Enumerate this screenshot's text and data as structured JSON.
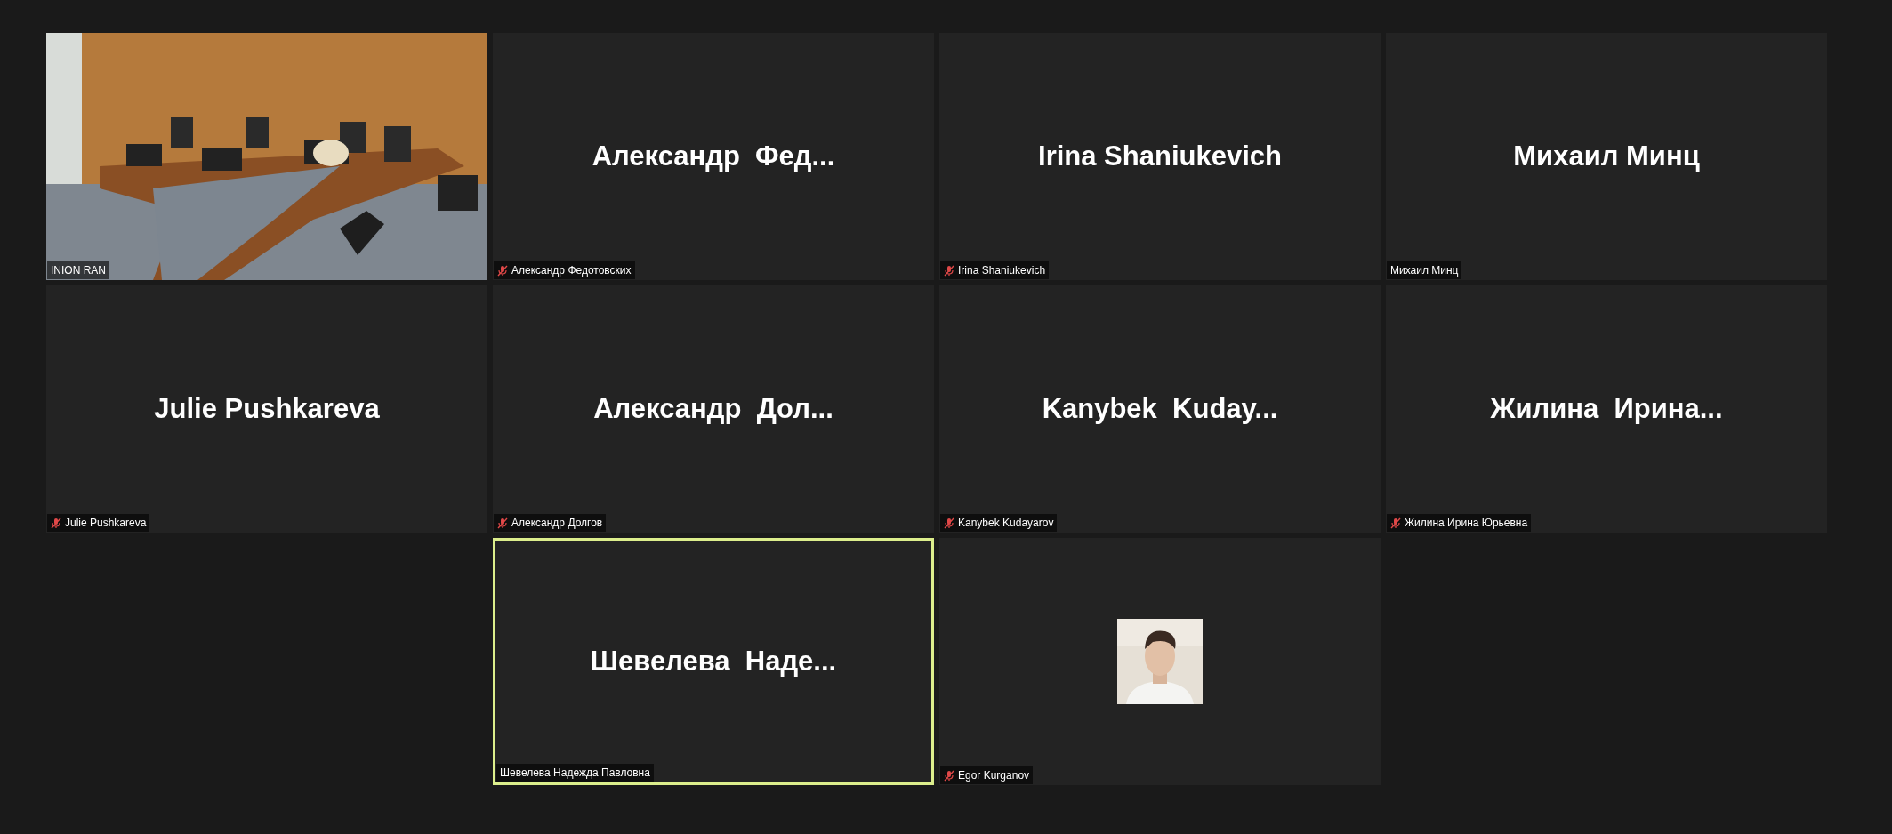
{
  "tiles": [
    {
      "kind": "video",
      "label": "INION RAN",
      "muted": false,
      "active_speaker": false
    },
    {
      "kind": "name",
      "display_name": "Александр  Фед...",
      "label": "Александр Федотовских",
      "muted": true,
      "active_speaker": false
    },
    {
      "kind": "name",
      "display_name": "Irina Shaniukevich",
      "label": "Irina Shaniukevich",
      "muted": true,
      "active_speaker": false
    },
    {
      "kind": "name",
      "display_name": "Михаил Минц",
      "label": "Михаил Минц",
      "muted": false,
      "active_speaker": false
    },
    {
      "kind": "name",
      "display_name": "Julie Pushkareva",
      "label": "Julie Pushkareva",
      "muted": true,
      "active_speaker": false
    },
    {
      "kind": "name",
      "display_name": "Александр  Дол...",
      "label": "Александр Долгов",
      "muted": true,
      "active_speaker": false
    },
    {
      "kind": "name",
      "display_name": "Kanybek  Kuday...",
      "label": "Kanybek Kudayarov",
      "muted": true,
      "active_speaker": false
    },
    {
      "kind": "name",
      "display_name": "Жилина  Ирина...",
      "label": "Жилина Ирина Юрьевна",
      "muted": true,
      "active_speaker": false
    },
    {
      "kind": "name",
      "display_name": "Шевелева  Наде...",
      "label": "Шевелева Надежда Павловна",
      "muted": false,
      "active_speaker": true
    },
    {
      "kind": "avatar",
      "label": "Egor Kurganov",
      "muted": true,
      "active_speaker": false
    }
  ]
}
